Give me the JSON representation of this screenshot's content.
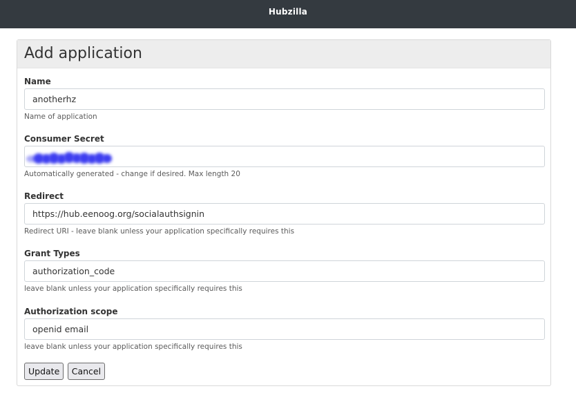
{
  "topbar": {
    "brand": "Hubzilla"
  },
  "page": {
    "title": "Add application"
  },
  "form": {
    "name": {
      "label": "Name",
      "value": "anotherhz",
      "help": "Name of application"
    },
    "consumer_secret": {
      "label": "Consumer Secret",
      "value": "",
      "help": "Automatically generated - change if desired. Max length 20"
    },
    "redirect": {
      "label": "Redirect",
      "value": "https://hub.eenoog.org/socialauthsignin",
      "help": "Redirect URI - leave blank unless your application specifically requires this"
    },
    "grant_types": {
      "label": "Grant Types",
      "value": "authorization_code",
      "help": "leave blank unless your application specifically requires this"
    },
    "authorization_scope": {
      "label": "Authorization scope",
      "value": "openid email",
      "help": "leave blank unless your application specifically requires this"
    }
  },
  "buttons": {
    "update": "Update",
    "cancel": "Cancel"
  },
  "colors": {
    "topbar": "#343a40",
    "header": "#ededed",
    "redaction": "#3f3ff0"
  }
}
